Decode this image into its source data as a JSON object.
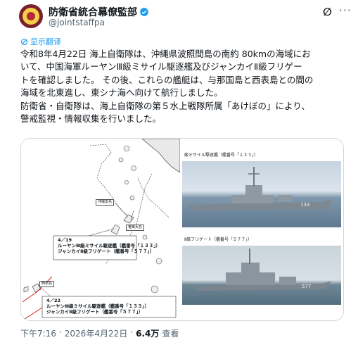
{
  "header": {
    "display_name": "防衛省統合幕僚監部",
    "handle": "@jointstaffpa",
    "grok_label": "∅",
    "more_label": "···"
  },
  "translate_label": "显示翻译",
  "body_text": "令和8年4月22日 海上自衛隊は、沖縄県波照間島の南約 80kmの海域にお\nいて、中国海軍ルーヤンⅢ級ミサイル駆逐艦及びジャンカイⅡ級フリゲー\nトを確認しました。 その後、これらの艦艇は、与那国島と西表島との間の\n海域を北東進し、東シナ海へ向けて航行しました。\n防衛省・自衛隊は、海上自衛隊の第５水上戦隊所属「あけぼの」により、\n警戒監視・情報収集を行いました。",
  "map": {
    "label_okinawa": "沖縄本島",
    "label_amami": "奄美大島",
    "label_iriomote": "西表島",
    "callout1_date": "4／19",
    "callout1_ship1": "ルーヤンⅢ級ミサイル駆逐艦（艦番号「１３３」）",
    "callout1_ship2": "ジャンカイⅡ級フリゲート（艦番号「５７７」）",
    "callout2_date": "4／22",
    "callout2_ship1": "ルーヤンⅢ級ミサイル駆逐艦（艦番号「１３３」）",
    "callout2_ship2": "ジャンカイⅡ級フリゲート（艦番号「５７７」）"
  },
  "photos": {
    "caption1": "級ミサイル駆逐艦（艦番号「１３３」）",
    "caption2": "Ⅱ級フリゲート（艦番号「５７７」）"
  },
  "footer": {
    "time": "下午7:16",
    "separator1": "·",
    "date": "2026年4月22日",
    "separator2": "·",
    "views_count": "6.4万",
    "views_label": "查看"
  },
  "colors": {
    "avatar_bg": "#7a1f2e",
    "verified": "#1d9bf0",
    "link": "#1d9bf0",
    "route": "#d22020"
  }
}
